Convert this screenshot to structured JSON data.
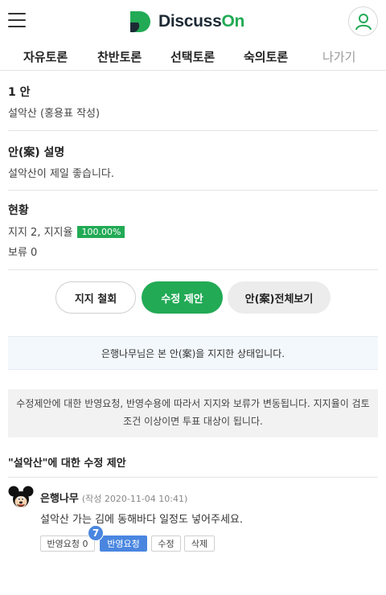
{
  "header": {
    "logo_text_main": "Discuss",
    "logo_text_accent": "On",
    "menu_icon": "hamburger-icon",
    "profile_icon": "user-icon",
    "brand_color": "#22aa55"
  },
  "nav": {
    "items": [
      {
        "label": "자유토론"
      },
      {
        "label": "찬반토론"
      },
      {
        "label": "선택토론"
      },
      {
        "label": "숙의토론"
      }
    ],
    "exit_label": "나가기"
  },
  "proposal": {
    "number_title": "1 안",
    "name": "설악산 (홍용표 작성)",
    "desc_title": "안(案) 설명",
    "desc_text": "설악산이 제일 좋습니다.",
    "status_title": "현황",
    "support_text": "지지 2,  지지율",
    "support_rate": "100.00%",
    "hold_text": "보류 0"
  },
  "actions": {
    "withdraw_label": "지지 철회",
    "propose_label": "수정 제안",
    "view_all_label": "안(案)전체보기"
  },
  "status_message": "은행나무님은 본 안(案)을 지지한 상태입니다.",
  "notice": "수정제안에 대한 반영요청, 반영수용에 따라서 지지와 보류가 변동됩니다. 지지율이 검토 조건 이상이면 투표 대상이 됩니다.",
  "modifications": {
    "title": "\"설악산\"에 대한 수정 제안",
    "comments": [
      {
        "author": "은행나무",
        "meta": "(작성 2020-11-04 10:41)",
        "body": "설악산 가는 김에 동해바다 일정도 넣어주세요.",
        "avatar_icon": "mickey-avatar",
        "request_label": "반영요청 0",
        "request_count": "7",
        "request_active_label": "반영요청",
        "edit_label": "수정",
        "delete_label": "삭제",
        "accent_color": "#4a86e0"
      }
    ]
  }
}
